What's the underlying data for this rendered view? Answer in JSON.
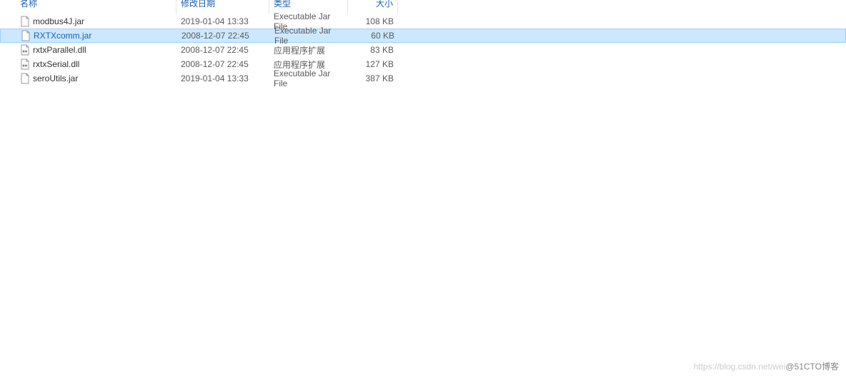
{
  "columns": {
    "name": "名称",
    "date": "修改日期",
    "type": "类型",
    "size": "大小"
  },
  "files": [
    {
      "name": "modbus4J.jar",
      "date": "2019-01-04 13:33",
      "type": "Executable Jar File",
      "size": "108 KB",
      "icon": "jar",
      "selected": false
    },
    {
      "name": "RXTXcomm.jar",
      "date": "2008-12-07 22:45",
      "type": "Executable Jar File",
      "size": "60 KB",
      "icon": "jar",
      "selected": true
    },
    {
      "name": "rxtxParallel.dll",
      "date": "2008-12-07 22:45",
      "type": "应用程序扩展",
      "size": "83 KB",
      "icon": "dll",
      "selected": false
    },
    {
      "name": "rxtxSerial.dll",
      "date": "2008-12-07 22:45",
      "type": "应用程序扩展",
      "size": "127 KB",
      "icon": "dll",
      "selected": false
    },
    {
      "name": "seroUtils.jar",
      "date": "2019-01-04 13:33",
      "type": "Executable Jar File",
      "size": "387 KB",
      "icon": "jar",
      "selected": false
    }
  ],
  "watermark": {
    "faded": "https://blog.csdn.net/wei",
    "dark": "@51CTO博客"
  }
}
